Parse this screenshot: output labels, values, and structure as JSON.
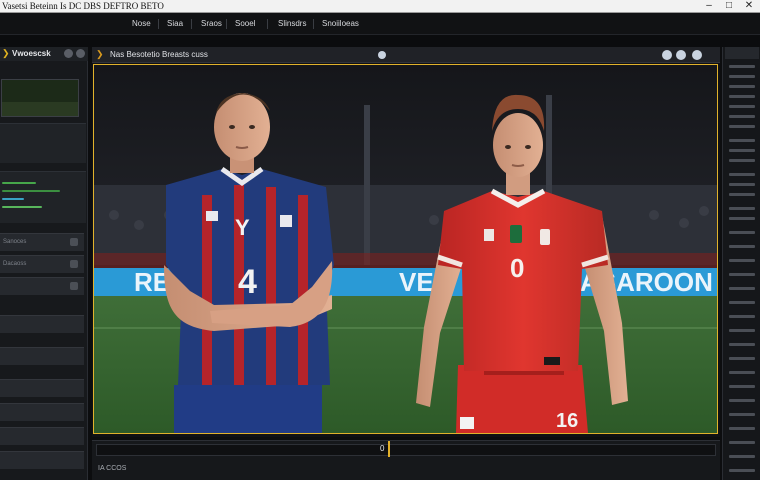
{
  "window": {
    "title": "Vasetsi Beteinn Is DC DBS DEFTRO BETO",
    "minimize": "–",
    "maximize": "□",
    "close": "✕"
  },
  "menu": {
    "items": [
      "Nose",
      "Siaa",
      "Sraos",
      "Sooel",
      "Slinsdrs",
      "Snoiiloeas"
    ]
  },
  "sidebar": {
    "title": "Vwoescsk",
    "rows": [
      "Sanoces",
      "Dacaoss",
      "",
      "",
      "",
      ""
    ]
  },
  "viewport": {
    "title": "Nas Besotetio Breasts cuss",
    "scene": {
      "banner_left": "RE",
      "banner_mid": "VE",
      "banner_right": "ASAROON",
      "left_player_number": "4",
      "left_player_chest": "Y",
      "right_player_number": "0",
      "right_player_shorts": "16"
    }
  },
  "timeline": {
    "timecode": "IA CCOS",
    "marker": "0"
  },
  "colors": {
    "accent": "#e1b22b",
    "viewport_border": "#e1b22b",
    "banner": "#2a9ad6",
    "red_kit": "#d9312e",
    "blue_kit": "#233c7e"
  }
}
